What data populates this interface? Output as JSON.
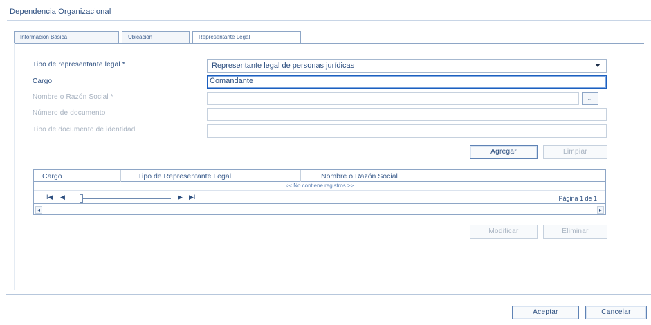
{
  "panel": {
    "title": "Dependencia Organizacional"
  },
  "tabs": [
    {
      "label": "Información Básica"
    },
    {
      "label": "Ubicación"
    },
    {
      "label": "Representante Legal"
    }
  ],
  "form": {
    "tipo_label": "Tipo de representante legal *",
    "tipo_value": "Representante legal de personas jurídicas",
    "cargo_label": "Cargo",
    "cargo_value": "Comandante",
    "nombre_label": "Nombre o Razón Social  *",
    "nombre_value": "",
    "lookup_label": "...",
    "numero_label": "Número de documento",
    "numero_value": "",
    "tipo_doc_label": "Tipo de documento de identidad",
    "tipo_doc_value": ""
  },
  "form_buttons": {
    "add": "Agregar",
    "clear": "Limpiar"
  },
  "grid": {
    "columns": [
      "Cargo",
      "Tipo de Representante Legal",
      "Nombre o Razón Social"
    ],
    "empty_message": "<< No contiene registros >>",
    "pager": {
      "first": "I◀",
      "prev": "◀",
      "next": "▶",
      "last": "▶I",
      "page_text": "Página 1 de 1"
    },
    "scroll": {
      "left": "◂",
      "right": "▸"
    }
  },
  "grid_buttons": {
    "modify": "Modificar",
    "delete": "Eliminar"
  },
  "dialog_buttons": {
    "accept": "Aceptar",
    "cancel": "Cancelar"
  }
}
